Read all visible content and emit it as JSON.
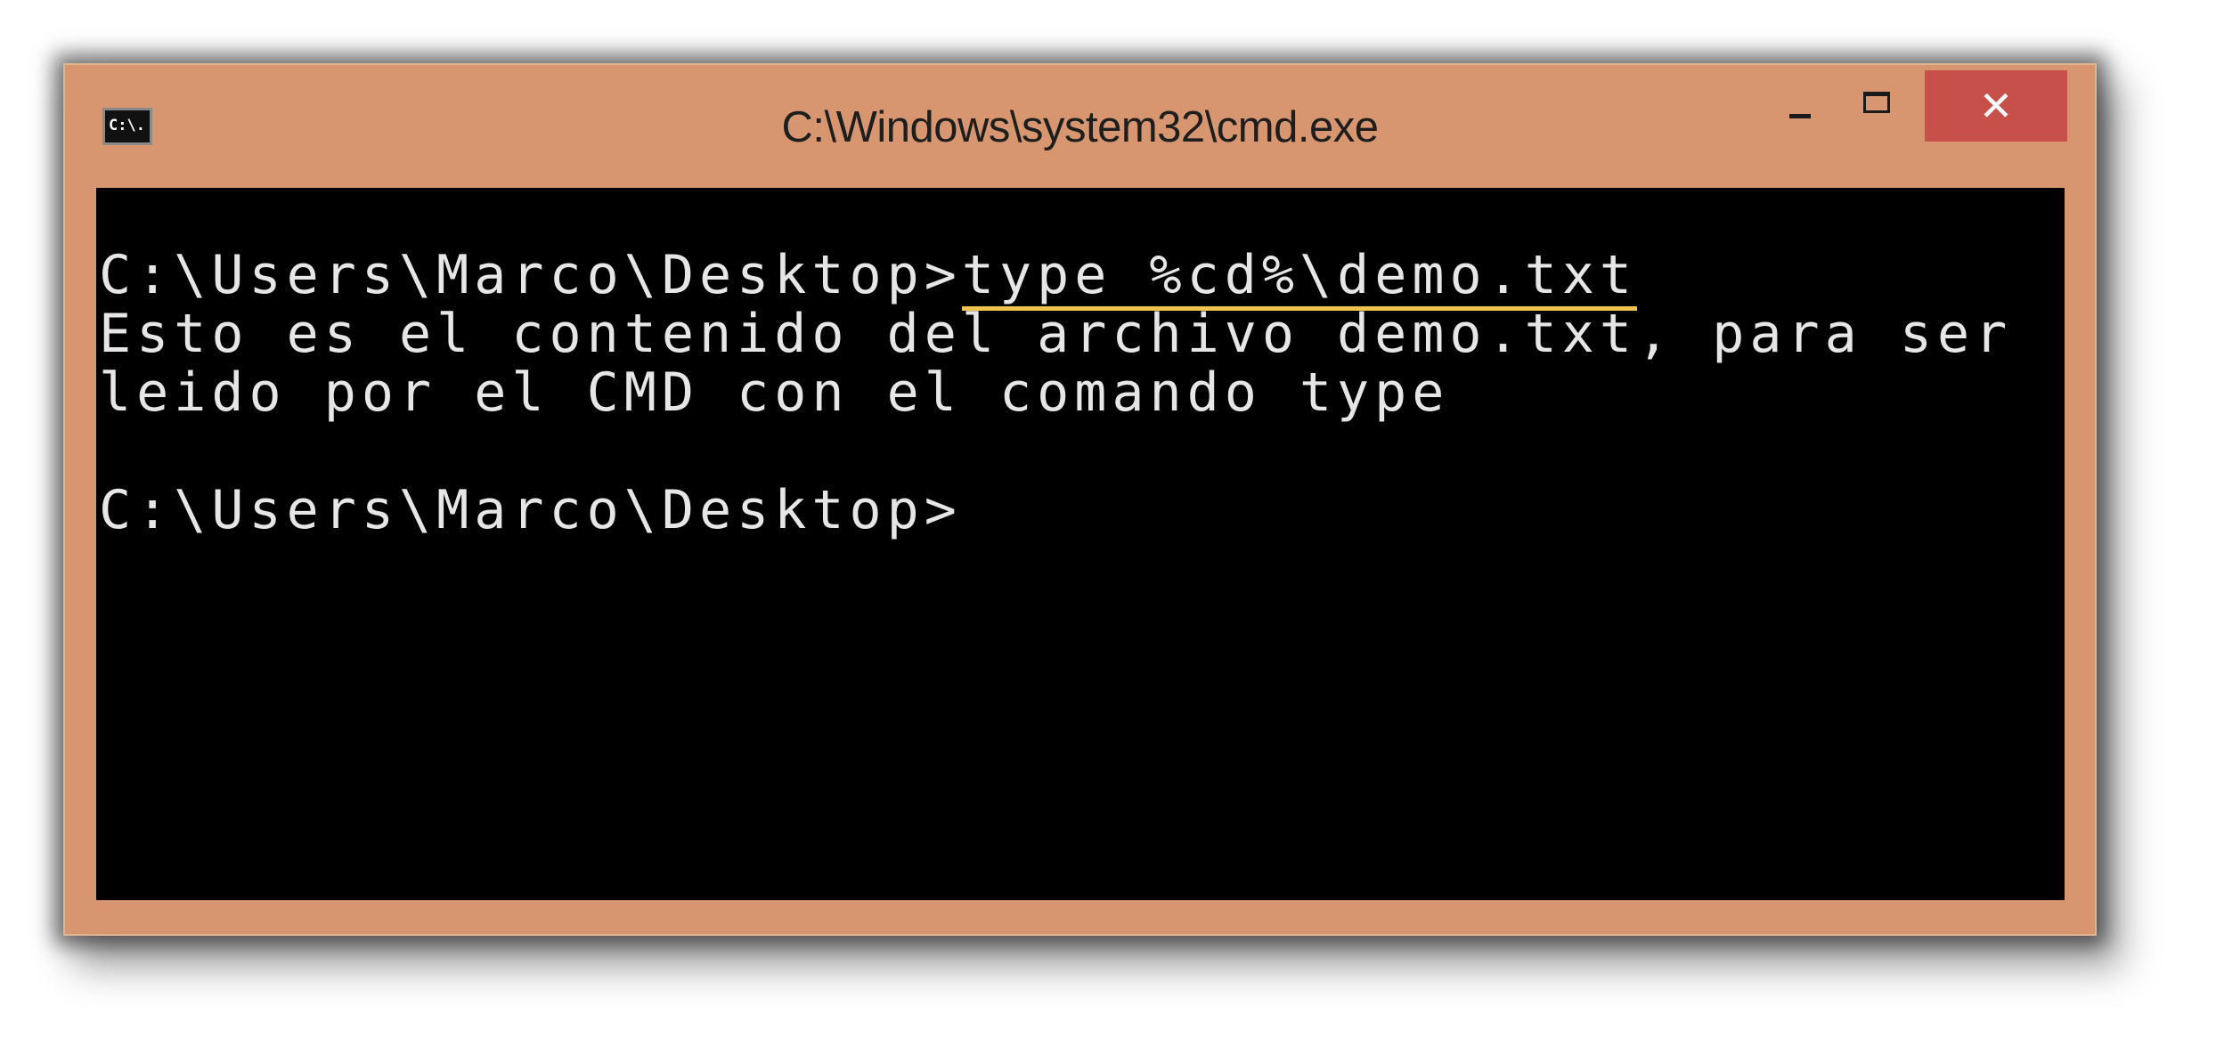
{
  "window": {
    "title": "C:\\Windows\\system32\\cmd.exe",
    "icon": "cmd-icon",
    "icon_text": "C:\\.",
    "frame_color": "#d7966f",
    "close_button_color": "#c7504a",
    "controls": {
      "minimize": "minimize-icon",
      "maximize": "maximize-icon",
      "close_label": "✕"
    }
  },
  "console": {
    "background": "#000000",
    "foreground": "#e6e6e6",
    "highlight_color": "#f0c44c",
    "lines": [
      {
        "prompt": "C:\\Users\\Marco\\Desktop>",
        "command": "type %cd%\\demo.txt"
      },
      {
        "text": "Esto es el contenido del archivo demo.txt, para ser"
      },
      {
        "text": "leido por el CMD con el comando type"
      },
      {
        "prompt": "C:\\Users\\Marco\\Desktop>"
      }
    ]
  }
}
